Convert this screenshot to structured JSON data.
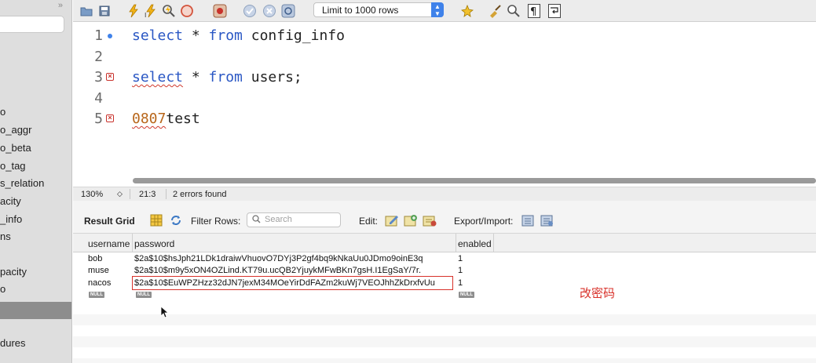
{
  "sidebar": {
    "collapse_glyph": "»",
    "items": [
      "o",
      "o_aggr",
      "o_beta",
      "o_tag",
      "s_relation",
      "acity",
      "_info",
      "ns",
      "pacity",
      "o",
      "dures"
    ]
  },
  "toolbar": {
    "limit_label": "Limit to 1000 rows",
    "icons": [
      "folder-open-icon",
      "save-icon",
      "execute-icon",
      "execute-current-icon",
      "explain-icon",
      "stop-icon",
      "toggle-error-icon",
      "commit-icon",
      "rollback-icon",
      "autocommit-icon",
      "beautify-icon",
      "broom-icon",
      "find-icon",
      "invisible-chars-icon",
      "wrap-icon"
    ]
  },
  "editor": {
    "lines": [
      {
        "num": "1",
        "marker": "dot",
        "keyword1": "select",
        "mid": " * ",
        "keyword2": "from",
        "rest": " config_info"
      },
      {
        "num": "2",
        "marker": "",
        "text": ""
      },
      {
        "num": "3",
        "marker": "error",
        "keyword1": "select",
        "mid": " * ",
        "keyword2": "from",
        "rest": " users;"
      },
      {
        "num": "4",
        "marker": "",
        "text": ""
      },
      {
        "num": "5",
        "marker": "error",
        "err_part": "0807",
        "rest": "test"
      }
    ]
  },
  "status": {
    "zoom": "130%",
    "position": "21:3",
    "errors": "2 errors found"
  },
  "result_toolbar": {
    "result_grid": "Result Grid",
    "filter_rows": "Filter Rows:",
    "search_placeholder": "Search",
    "edit": "Edit:",
    "export_import": "Export/Import:"
  },
  "grid": {
    "columns": [
      "username",
      "password",
      "enabled"
    ],
    "rows": [
      {
        "username": "bob",
        "password": "$2a$10$hsJph21LDk1draiwVhuovO7DYj3P2gf4bq9kNkaUu0JDmo9oinE3q",
        "enabled": "1"
      },
      {
        "username": "muse",
        "password": "$2a$10$m9y5xON4OZLind.KT79u.ucQB2YjuykMFwBKn7gsH.I1EgSaY/7r.",
        "enabled": "1"
      },
      {
        "username": "nacos",
        "password": "$2a$10$EuWPZHzz32dJN7jexM34MOeYirDdFAZm2kuWj7VEOJhhZkDrxfvUu",
        "enabled": "1"
      }
    ],
    "null_label": "NULL"
  },
  "annotation": "改密码"
}
